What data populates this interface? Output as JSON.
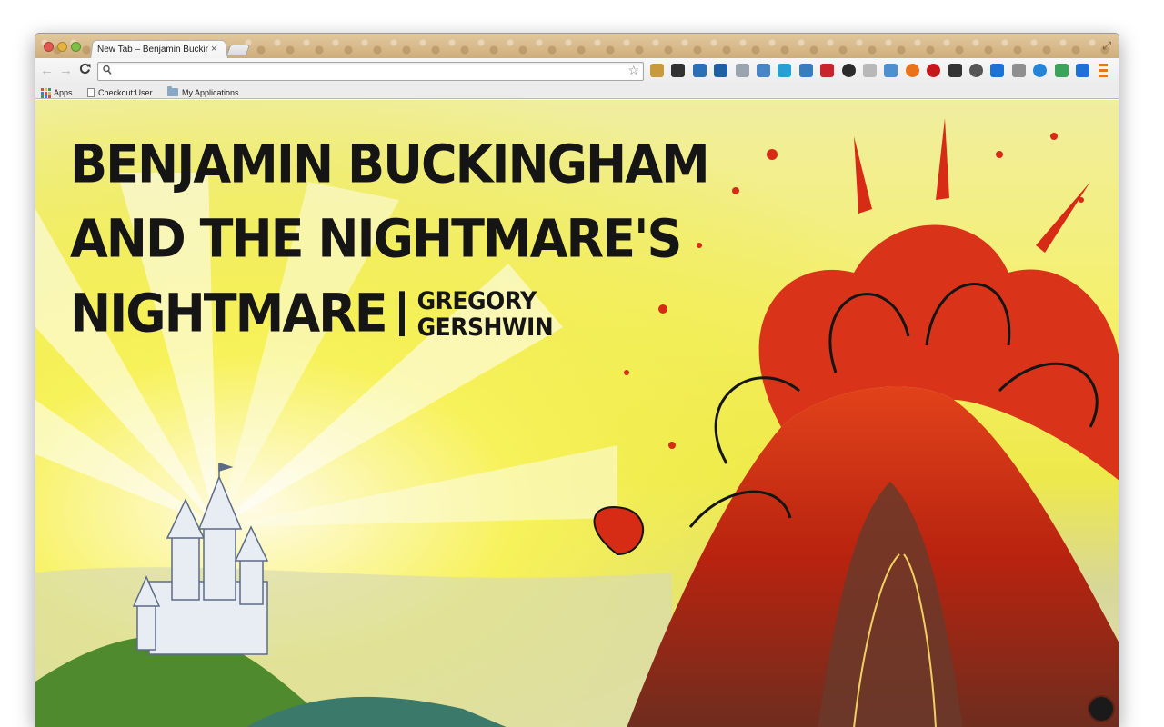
{
  "tab": {
    "title": "New Tab – Benjamin Bucking",
    "close_glyph": "×"
  },
  "toolbar": {
    "back_glyph": "←",
    "forward_glyph": "→",
    "reload_glyph": "C",
    "omnibox_value": "",
    "omnibox_placeholder": "",
    "search_icon": "search-icon",
    "star_icon": "bookmark-star-icon"
  },
  "extensions": [
    {
      "name": "key-extension-icon",
      "color": "#c99a3c"
    },
    {
      "name": "eyedropper-extension-icon",
      "color": "#333333"
    },
    {
      "name": "on-badge-extension-icon",
      "color": "#2a6fb8"
    },
    {
      "name": "x-badge-extension-icon",
      "color": "#1f5fa6"
    },
    {
      "name": "shield-extension-icon",
      "color": "#9aa4ae"
    },
    {
      "name": "window-extension-icon",
      "color": "#4a86c6"
    },
    {
      "name": "c-extension-icon",
      "color": "#2a9fd6"
    },
    {
      "name": "crop-extension-icon",
      "color": "#3a7dbf"
    },
    {
      "name": "asterisk-extension-icon",
      "color": "#c8252c"
    },
    {
      "name": "circle-extension-icon",
      "color": "#2b2b2b"
    },
    {
      "name": "in-extension-icon",
      "color": "#b8b8b8"
    },
    {
      "name": "dock-extension-icon",
      "color": "#4d8fd1"
    },
    {
      "name": "flame-extension-icon",
      "color": "#e8731c"
    },
    {
      "name": "abp-extension-icon",
      "color": "#c8161d"
    },
    {
      "name": "film-extension-icon",
      "color": "#333333"
    },
    {
      "name": "dot-extension-icon",
      "color": "#555555"
    },
    {
      "name": "arrow-extension-icon",
      "color": "#1e72d6"
    },
    {
      "name": "gradient-extension-icon",
      "color": "#8f8f8f"
    },
    {
      "name": "ring-extension-icon",
      "color": "#2586d9"
    },
    {
      "name": "grid-extension-icon",
      "color": "#3ba35a"
    },
    {
      "name": "arrow-2-extension-icon",
      "color": "#1e72d6"
    },
    {
      "name": "menu-icon",
      "color": "#e07a1f"
    }
  ],
  "bookmarks": {
    "apps_label": "Apps",
    "items": [
      {
        "label": "Checkout:User",
        "icon": "page-icon"
      },
      {
        "label": "My Applications",
        "icon": "folder-icon"
      }
    ]
  },
  "cover": {
    "title_line_1": "Benjamin Buckingham",
    "title_line_2": "and the Nightmare's",
    "title_line_3": "Nightmare",
    "author": "Gregory Gershwin"
  },
  "colors": {
    "sky_yellow": "#f5f06a",
    "volcano_red": "#d62b14",
    "ink": "#151515",
    "hill_green": "#4f8a2e"
  }
}
